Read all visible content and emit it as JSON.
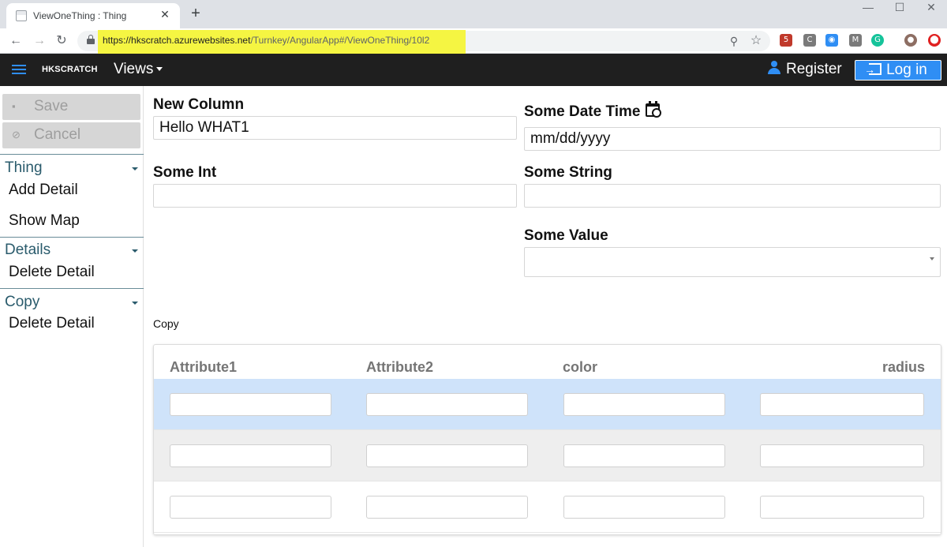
{
  "browser": {
    "tab_title": "ViewOneThing : Thing",
    "tab_close": "✕",
    "new_tab": "+",
    "window_controls": [
      "—",
      "☐",
      "✕"
    ],
    "nav": {
      "back": "←",
      "forward": "→",
      "reload": "↻"
    },
    "url_host": "https://hkscratch.azurewebsites.net",
    "url_path": "/Turnkey/AngularApp#/ViewOneThing/10l2",
    "toolbar_icons": {
      "zoom": "⚲",
      "star": "☆"
    },
    "extensions": [
      {
        "name": "extension-badge-icon",
        "label": "5",
        "color": "#c0392b"
      },
      {
        "name": "extension-c-icon",
        "label": "C",
        "color": "#7a7a7a"
      },
      {
        "name": "extension-globe-icon",
        "label": "◉",
        "color": "#2f8ef4"
      },
      {
        "name": "extension-m-icon",
        "label": "M",
        "color": "#7a7a7a"
      },
      {
        "name": "extension-grammarly-icon",
        "label": "G",
        "color": "#15c39a"
      },
      {
        "name": "profile-avatar-icon",
        "label": "●",
        "color": "#8d6e63"
      },
      {
        "name": "extension-red-icon",
        "label": "⬤",
        "color": "#e02020"
      }
    ]
  },
  "appbar": {
    "brand": "HKSCRATCH",
    "views_label": "Views",
    "register_label": "Register",
    "login_label": "Log in"
  },
  "sidebar": {
    "save_label": "Save",
    "cancel_label": "Cancel",
    "save_icon": "▪",
    "cancel_icon": "⊘",
    "sections": [
      {
        "title": "Thing",
        "items": [
          "Add Detail",
          "Show Map"
        ]
      },
      {
        "title": "Details",
        "items": [
          "Delete Detail"
        ]
      },
      {
        "title": "Copy",
        "items": [
          "Delete Detail"
        ]
      }
    ]
  },
  "form": {
    "new_column": {
      "label": "New Column",
      "value": "Hello WHAT1"
    },
    "some_date_time": {
      "label": "Some Date Time",
      "placeholder": "mm/dd/yyyy"
    },
    "some_int": {
      "label": "Some Int",
      "value": ""
    },
    "some_string": {
      "label": "Some String",
      "value": ""
    },
    "some_value": {
      "label": "Some Value",
      "value": ""
    }
  },
  "copy_grid": {
    "title": "Copy",
    "columns": [
      "Attribute1",
      "Attribute2",
      "color",
      "radius"
    ],
    "row_colors": [
      "#cfe3fa",
      "#eeeeee",
      "#ffffff"
    ]
  },
  "colors": {
    "appbar_bg": "#1f1f1f",
    "accent": "#2f8ef4",
    "section_title": "#2a5b6c",
    "url_highlight": "#f5f542"
  }
}
